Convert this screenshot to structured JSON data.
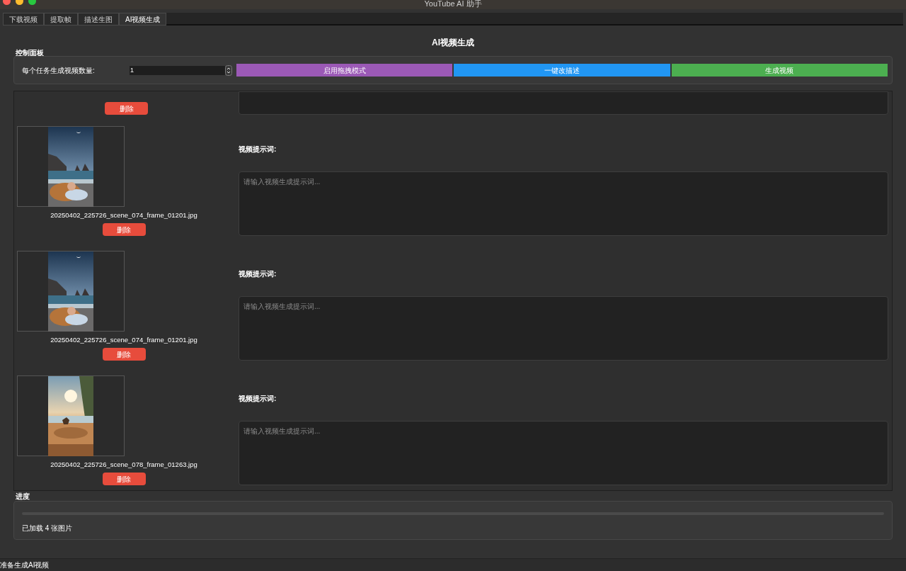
{
  "window": {
    "title": "YouTube AI 助手"
  },
  "tabs": [
    {
      "label": "下载视频",
      "selected": false
    },
    {
      "label": "提取帧",
      "selected": false
    },
    {
      "label": "描述生图",
      "selected": false
    },
    {
      "label": "AI视频生成",
      "selected": true
    }
  ],
  "heading": "AI视频生成",
  "control_panel": {
    "title": "控制面板",
    "count_label": "每个任务生成视频数量:",
    "count_value": "1",
    "buttons": [
      {
        "label": "启用拖拽模式",
        "color": "#9b59b6"
      },
      {
        "label": "一键改描述",
        "color": "#2196f3"
      },
      {
        "label": "生成视频",
        "color": "#4caf50"
      }
    ]
  },
  "items": [
    {
      "kind": "partial",
      "delete": "删除"
    },
    {
      "kind": "full",
      "filename": "20250402_225726_scene_074_frame_01201.jpg",
      "delete": "删除",
      "prompt_label": "视频提示词:",
      "placeholder": "请输入视频生成提示词..."
    },
    {
      "kind": "full",
      "filename": "20250402_225726_scene_074_frame_01201.jpg",
      "delete": "删除",
      "prompt_label": "视频提示词:",
      "placeholder": "请输入视频生成提示词..."
    },
    {
      "kind": "full",
      "filename": "20250402_225726_scene_078_frame_01263.jpg",
      "delete": "删除",
      "prompt_label": "视频提示词:",
      "placeholder": "请输入视频生成提示词..."
    }
  ],
  "progress": {
    "title": "进度",
    "level": 0,
    "message": "已加载 4 张图片"
  },
  "status_bar": "准备生成AI视频"
}
